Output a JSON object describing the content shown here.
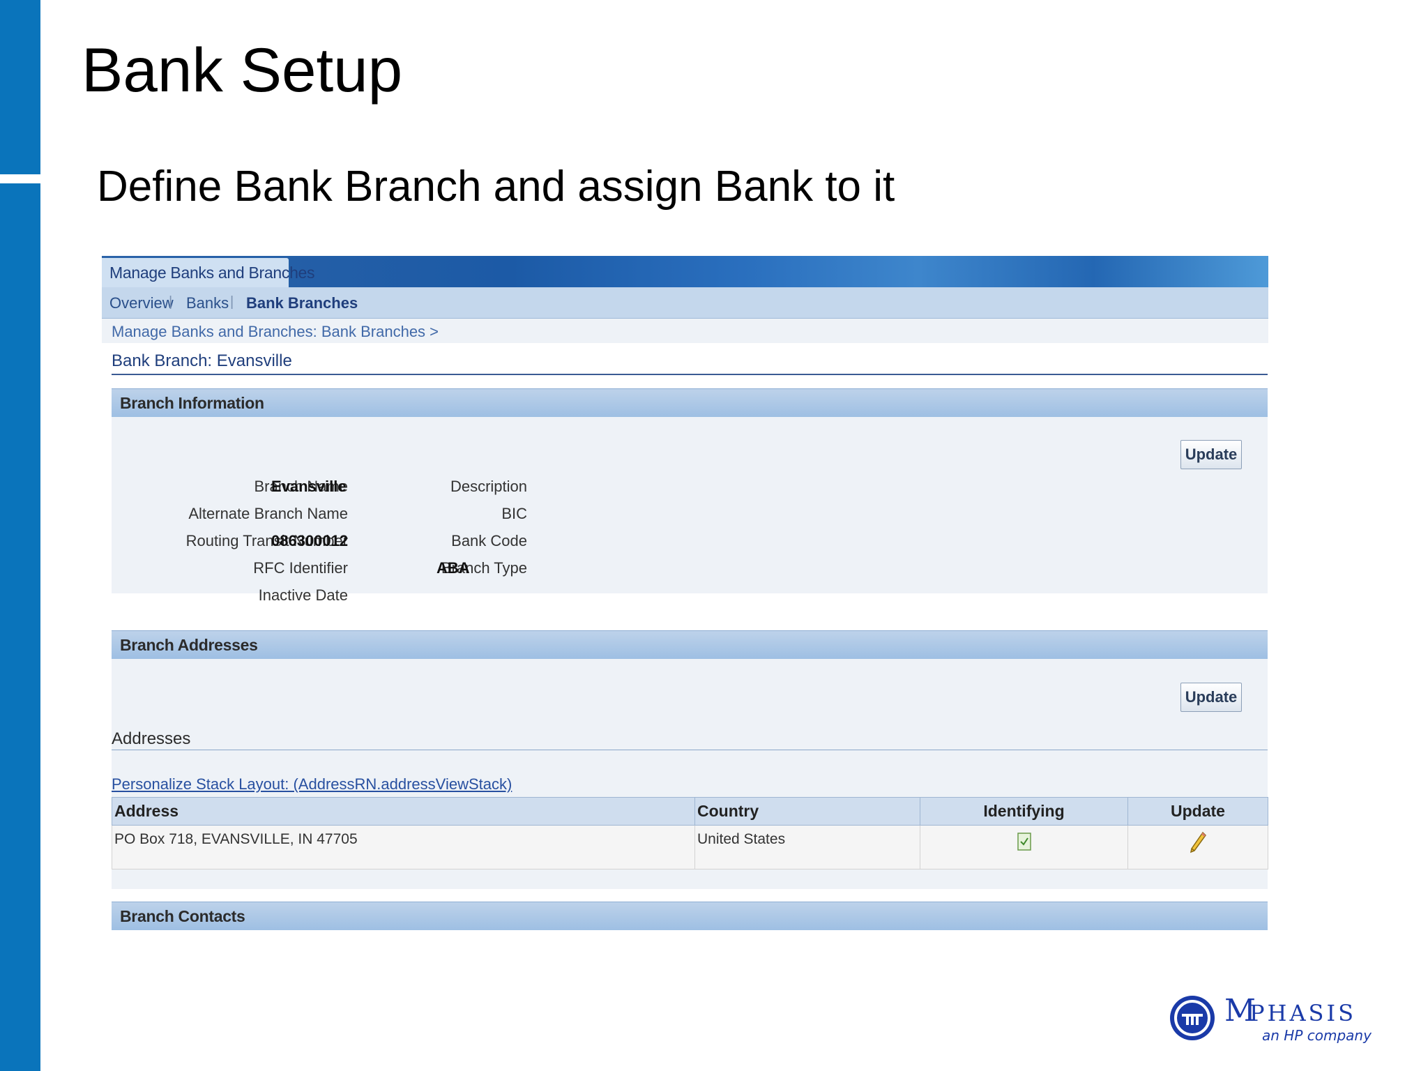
{
  "slide": {
    "title": "Bank Setup",
    "subtitle": "Define Bank Branch and assign Bank to it"
  },
  "app": {
    "header_tab": "Manage Banks and Branches",
    "subnav": [
      "Overview",
      "Banks",
      "Bank Branches"
    ],
    "active_subnav": "Bank Branches",
    "breadcrumb": "Manage Banks and Branches: Bank Branches  >",
    "page_title": "Bank Branch: Evansville"
  },
  "branch_information": {
    "heading": "Branch Information",
    "update_label": "Update",
    "fields_left": [
      {
        "label": "Branch Name",
        "value": "Evansville"
      },
      {
        "label": "Alternate Branch Name",
        "value": ""
      },
      {
        "label": "Routing Transit Number",
        "value": "086300012"
      },
      {
        "label": "RFC Identifier",
        "value": ""
      },
      {
        "label": "Inactive Date",
        "value": ""
      }
    ],
    "fields_right": [
      {
        "label": "Description",
        "value": ""
      },
      {
        "label": "BIC",
        "value": ""
      },
      {
        "label": "Bank Code",
        "value": ""
      },
      {
        "label": "Branch Type",
        "value": "ABA"
      }
    ]
  },
  "branch_addresses": {
    "heading": "Branch Addresses",
    "update_label": "Update",
    "subheading": "Addresses",
    "personalize_link": "Personalize Stack Layout: (AddressRN.addressViewStack)",
    "columns": [
      "Address",
      "Country",
      "Identifying",
      "Update"
    ],
    "rows": [
      {
        "address": "PO Box 718, EVANSVILLE, IN 47705",
        "country": "United States",
        "identifying_icon": "checked-box-icon",
        "update_icon": "pencil-icon"
      }
    ]
  },
  "branch_contacts": {
    "heading": "Branch Contacts"
  },
  "logo": {
    "name": "MPHASIS",
    "tagline": "an HP company"
  },
  "colors": {
    "brand_blue": "#0a74bb",
    "header_blue": "#1c5aa6",
    "link_blue": "#2850a0"
  }
}
